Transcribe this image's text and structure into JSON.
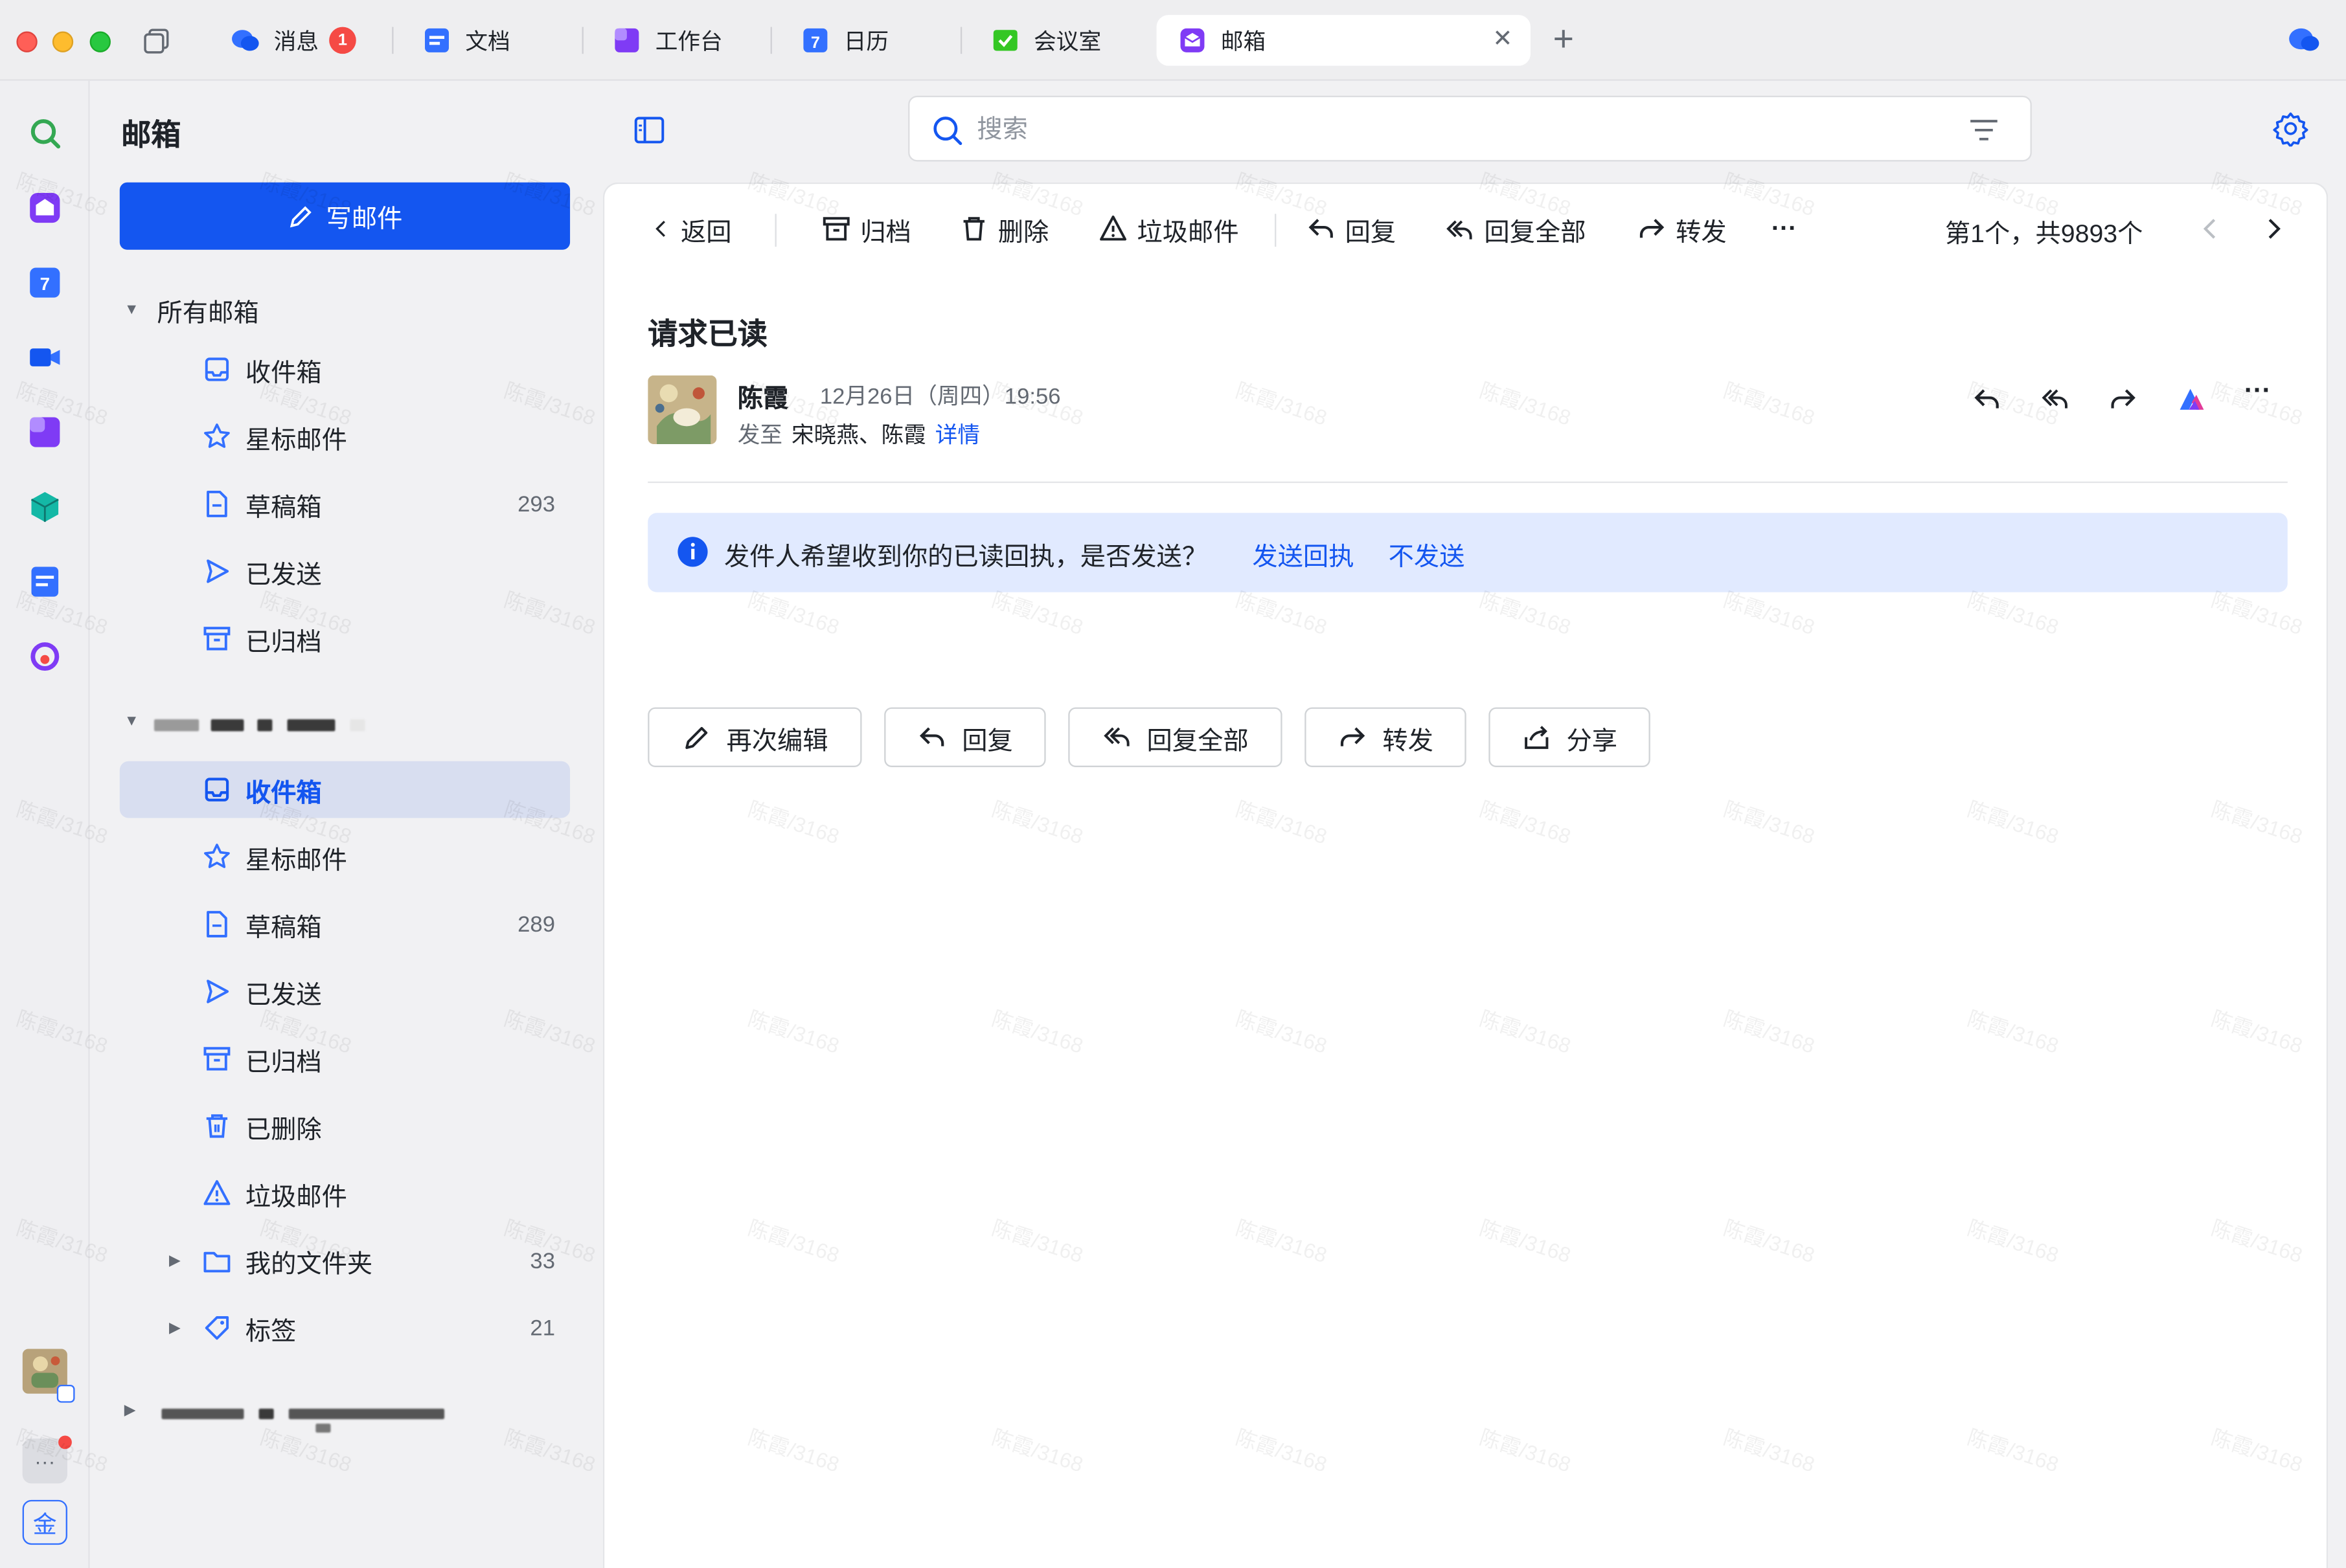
{
  "tabs": [
    {
      "label": "消息",
      "badge": "1",
      "icon": "chat-icon"
    },
    {
      "label": "文档",
      "icon": "docs-icon"
    },
    {
      "label": "工作台",
      "icon": "workplace-icon"
    },
    {
      "label": "日历",
      "icon": "calendar-icon"
    },
    {
      "label": "会议室",
      "icon": "meeting-room-icon"
    },
    {
      "label": "邮箱",
      "icon": "mail-icon",
      "active": true
    }
  ],
  "colors": {
    "accent": "#1456f0",
    "badge": "#f54a45",
    "receipt_bg": "#e1eaff"
  },
  "sidebar": {
    "title": "邮箱",
    "compose_label": "写邮件",
    "all_mailboxes": {
      "label": "所有邮箱",
      "items": [
        {
          "label": "收件箱",
          "icon": "inbox-icon"
        },
        {
          "label": "星标邮件",
          "icon": "star-icon"
        },
        {
          "label": "草稿箱",
          "icon": "draft-icon",
          "count": "293"
        },
        {
          "label": "已发送",
          "icon": "sent-icon"
        },
        {
          "label": "已归档",
          "icon": "archive-icon"
        }
      ]
    },
    "account": {
      "items": [
        {
          "label": "收件箱",
          "icon": "inbox-icon",
          "active": true
        },
        {
          "label": "星标邮件",
          "icon": "star-icon"
        },
        {
          "label": "草稿箱",
          "icon": "draft-icon",
          "count": "289"
        },
        {
          "label": "已发送",
          "icon": "sent-icon"
        },
        {
          "label": "已归档",
          "icon": "archive-icon"
        },
        {
          "label": "已删除",
          "icon": "trash-icon"
        },
        {
          "label": "垃圾邮件",
          "icon": "spam-icon"
        },
        {
          "label": "我的文件夹",
          "icon": "folder-icon",
          "count": "33"
        },
        {
          "label": "标签",
          "icon": "tag-icon",
          "count": "21"
        }
      ]
    }
  },
  "search": {
    "placeholder": "搜索"
  },
  "toolbar": {
    "back": "返回",
    "archive": "归档",
    "delete": "删除",
    "spam": "垃圾邮件",
    "reply": "回复",
    "reply_all": "回复全部",
    "forward": "转发",
    "more": "···",
    "pager": "第1个，共9893个"
  },
  "message": {
    "subject": "请求已读",
    "sender": "陈霞",
    "time": "12月26日（周四）19:56",
    "to_prefix": "发至",
    "to_names": "宋晓燕、陈霞",
    "details": "详情"
  },
  "receipt": {
    "text": "发件人希望收到你的已读回执，是否发送？",
    "send": "发送回执",
    "dont_send": "不发送"
  },
  "actions": {
    "edit_again": "再次编辑",
    "reply": "回复",
    "reply_all": "回复全部",
    "forward": "转发",
    "share": "分享"
  },
  "rail": {
    "badge_char": "金"
  },
  "watermark": "陈霞/3168"
}
